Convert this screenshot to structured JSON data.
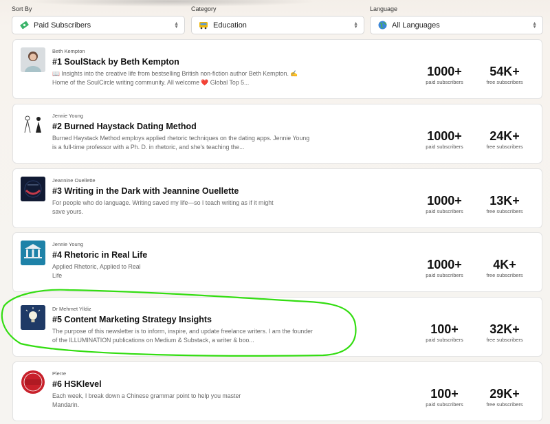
{
  "filters": [
    {
      "label": "Sort By",
      "value": "Paid Subscribers",
      "icon": "money-icon"
    },
    {
      "label": "Category",
      "value": "Education",
      "icon": "bus-icon"
    },
    {
      "label": "Language",
      "value": "All Languages",
      "icon": "globe-icon"
    }
  ],
  "newsletters": [
    {
      "author": "Beth Kempton",
      "title": "#1 SoulStack by Beth Kempton",
      "desc": "📖 Insights into the creative life from bestselling British non-fiction author Beth Kempton. ✍️Home of the SoulCircle writing community. All welcome ❤️ Global Top 5...",
      "paid": "1000+",
      "paid_label": "paid subscribers",
      "free": "54K+",
      "free_label": "free subscribers"
    },
    {
      "author": "Jennie Young",
      "title": "#2 Burned Haystack Dating Method",
      "desc": "Burned Haystack Method employs applied rhetoric techniques on the dating apps. Jennie Young is a full-time professor with a Ph. D. in rhetoric, and she's teaching the...",
      "paid": "1000+",
      "paid_label": "paid subscribers",
      "free": "24K+",
      "free_label": "free subscribers"
    },
    {
      "author": "Jeannine Ouellette",
      "title": "#3 Writing in the Dark with Jeannine Ouellette",
      "desc": "For people who do language. Writing saved my life—so I teach writing as if it might save yours.",
      "paid": "1000+",
      "paid_label": "paid subscribers",
      "free": "13K+",
      "free_label": "free subscribers"
    },
    {
      "author": "Jennie Young",
      "title": "#4 Rhetoric in Real Life",
      "desc": "Applied Rhetoric, Applied to Real Life",
      "paid": "1000+",
      "paid_label": "paid subscribers",
      "free": "4K+",
      "free_label": "free subscribers",
      "thumb_text": "RHETORIC IN REAL LIFE"
    },
    {
      "author": "Dr Mehmet Yildiz",
      "title": "#5 Content Marketing Strategy Insights",
      "desc": "The purpose of this newsletter is to inform, inspire, and update freelance writers. I am the founder of the ILLUMINATION publications on Medium & Substack, a writer & boo...",
      "paid": "100+",
      "paid_label": "paid subscribers",
      "free": "32K+",
      "free_label": "free subscribers"
    },
    {
      "author": "Pierre",
      "title": "#6 HSKlevel",
      "desc": "Each week, I break down a Chinese grammar point to help you master Mandarin.",
      "paid": "100+",
      "paid_label": "paid subscribers",
      "free": "29K+",
      "free_label": "free subscribers",
      "thumb_text": "HSK LEVEL"
    }
  ],
  "colors": {
    "highlight": "#33dd11",
    "hsk_red": "#c8202a",
    "bulb_bg": "#1f3a66"
  }
}
